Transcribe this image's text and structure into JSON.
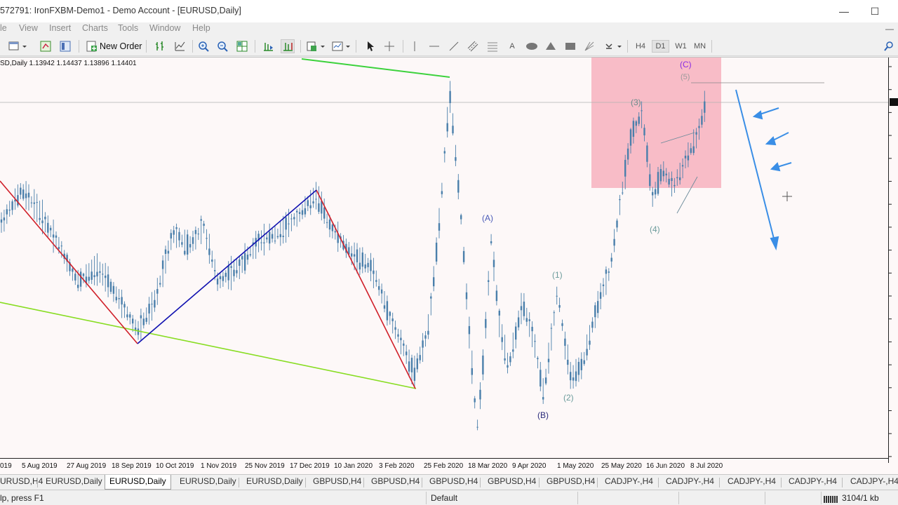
{
  "window": {
    "title": "572791: IronFXBM-Demo1 - Demo Account - [EURUSD,Daily]",
    "minimize_glyph": "—",
    "maximize_glyph": "☐"
  },
  "menu": [
    "le",
    "View",
    "Insert",
    "Charts",
    "Tools",
    "Window",
    "Help"
  ],
  "toolbar": {
    "new_order_label": "New Order",
    "timeframes": [
      "H4",
      "D1",
      "W1",
      "MN"
    ],
    "active_timeframe": "D1",
    "text_tool_label": "A"
  },
  "chart": {
    "symbol_info": "SD,Daily  1.13942 1.14437 1.13896 1.14401",
    "dates": [
      "019",
      "5 Aug 2019",
      "27 Aug 2019",
      "18 Sep 2019",
      "10 Oct 2019",
      "1 Nov 2019",
      "25 Nov 2019",
      "17 Dec 2019",
      "10 Jan 2020",
      "3 Feb 2020",
      "25 Feb 2020",
      "18 Mar 2020",
      "9 Apr 2020",
      "1 May 2020",
      "25 May 2020",
      "16 Jun 2020",
      "8 Jul 2020"
    ],
    "wave_labels": {
      "A": "(A)",
      "B": "(B)",
      "C": "(C)",
      "w1": "(1)",
      "w2": "(2)",
      "w3": "(3)",
      "w4": "(4)",
      "w5": "(5)"
    },
    "colors": {
      "background": "#fdf8f8",
      "candles": "#4a7fab",
      "trend_red": "#d0202a",
      "trend_blue": "#1010b0",
      "trend_green": "#88dd22",
      "top_green": "#3cd23c",
      "target_zone": "#f8b8c4",
      "forecast_arrows": "#3a8ee6",
      "wave_label_blue": "#4a5ab8",
      "wave_label_gray": "#6b9b9b",
      "wave_label_purple": "#8a2be2"
    }
  },
  "tabs": [
    "URUSD,H4",
    "EURUSD,Daily",
    "EURUSD,Daily",
    "EURUSD,Daily",
    "EURUSD,Daily",
    "GBPUSD,H4",
    "GBPUSD,H4",
    "GBPUSD,H4",
    "GBPUSD,H4",
    "GBPUSD,H4",
    "CADJPY-,H4",
    "CADJPY-,H4",
    "CADJPY-,H4",
    "CADJPY-,H4",
    "CADJPY-,H4"
  ],
  "active_tab_index": 2,
  "status": {
    "help": "lp, press F1",
    "profile": "Default",
    "connection": "3104/1 kb"
  }
}
